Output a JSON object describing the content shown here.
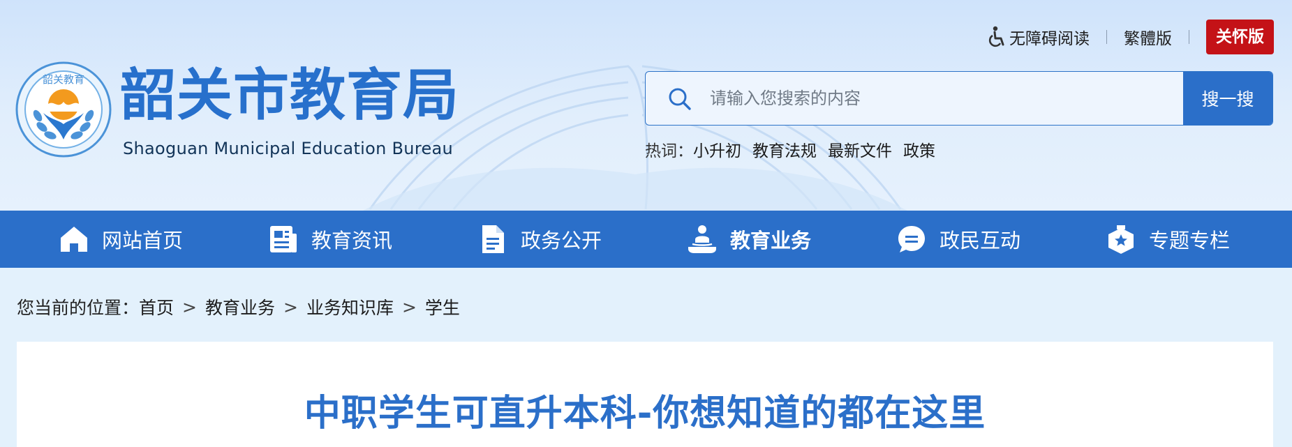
{
  "site": {
    "title_cn": "韶关市教育局",
    "title_en": "Shaoguan Municipal Education Bureau",
    "emblem_text": "韶关教育"
  },
  "top_links": {
    "accessibility": "无障碍阅读",
    "traditional": "繁體版",
    "care_mode": "关怀版"
  },
  "search": {
    "placeholder": "请输入您搜索的内容",
    "button": "搜一搜"
  },
  "hot_words": {
    "label": "热词：",
    "items": [
      "小升初",
      "教育法规",
      "最新文件",
      "政策"
    ]
  },
  "nav": {
    "items": [
      {
        "label": "网站首页",
        "icon": "home-icon"
      },
      {
        "label": "教育资讯",
        "icon": "news-icon"
      },
      {
        "label": "政务公开",
        "icon": "document-icon"
      },
      {
        "label": "教育业务",
        "icon": "education-service-icon"
      },
      {
        "label": "政民互动",
        "icon": "chat-icon"
      },
      {
        "label": "专题专栏",
        "icon": "badge-star-icon"
      }
    ],
    "active_index": 3
  },
  "breadcrumb": {
    "prefix": "您当前的位置：",
    "items": [
      "首页",
      "教育业务",
      "业务知识库",
      "学生"
    ],
    "separator": ">"
  },
  "article": {
    "title": "中职学生可直升本科-你想知道的都在这里"
  },
  "colors": {
    "primary": "#2b6fc9",
    "title_blue": "#2770cc",
    "care_red": "#c41217",
    "page_bg": "#e3f1fc"
  }
}
